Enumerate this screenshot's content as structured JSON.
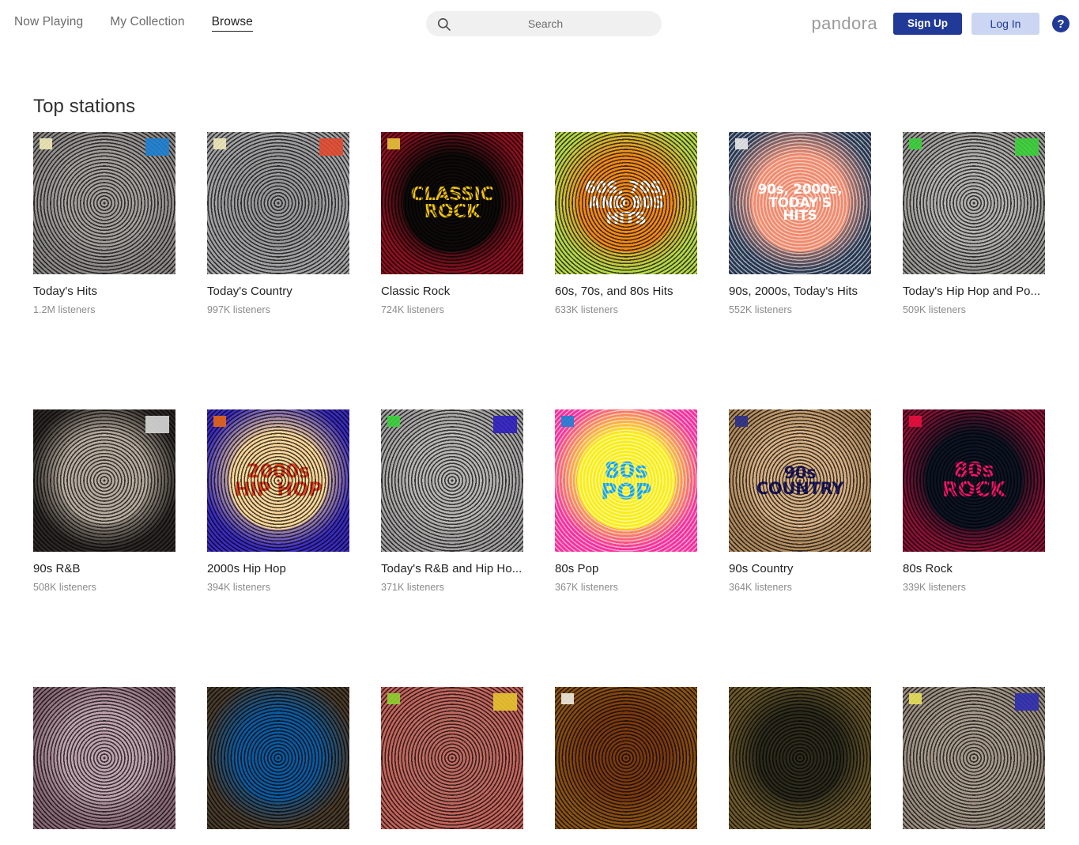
{
  "header": {
    "nav": [
      {
        "label": "Now Playing",
        "active": false
      },
      {
        "label": "My Collection",
        "active": false
      },
      {
        "label": "Browse",
        "active": true
      }
    ],
    "search": {
      "placeholder": "Search",
      "value": "",
      "icon": "search-icon"
    },
    "brand": "pandora",
    "sign_up_label": "Sign Up",
    "log_in_label": "Log In",
    "help_label": "?",
    "colors": {
      "brand_navy": "#223a97",
      "login_bg": "#ccd6f2",
      "search_bg": "#f0f0f0",
      "logo_gray": "#9b9b9b"
    }
  },
  "main": {
    "section_title": "Top stations",
    "stations": [
      {
        "title": "Today's Hits",
        "listeners": "1.2M listeners",
        "art": {
          "style": "photo",
          "bg": "#8d8a88",
          "disc": "#a5a19d",
          "label": "",
          "label_color": "#ffffff",
          "ring": "dark",
          "badge_tl": "#efe9b8",
          "badge_tr": "#1d7fd1"
        }
      },
      {
        "title": "Today's Country",
        "listeners": "997K listeners",
        "art": {
          "style": "photo",
          "bg": "#a3a2a4",
          "disc": "#9b9a9c",
          "label": "",
          "label_color": "#ffffff",
          "ring": "dark",
          "badge_tl": "#efe9b8",
          "badge_tr": "#e04a2f"
        }
      },
      {
        "title": "Classic Rock",
        "listeners": "724K listeners",
        "art": {
          "style": "graphic",
          "bg": "#8e1122",
          "disc": "#0d0a09",
          "label": "CLASSIC ROCK",
          "label_color": "#f2c411",
          "label_size": 23,
          "ring": "dark",
          "badge_tl": "#e8c53a",
          "badge_tr": ""
        }
      },
      {
        "title": "60s, 70s, and 80s Hits",
        "listeners": "633K listeners",
        "art": {
          "style": "graphic",
          "bg": "#b8d94a",
          "disc": "#f08a1c",
          "label": "60S, 70S, AND 80S HITS",
          "label_color": "#ffffff",
          "label_size": 20,
          "ring": "dark",
          "badge_tl": "",
          "badge_tr": ""
        }
      },
      {
        "title": "90s, 2000s, Today's Hits",
        "listeners": "552K listeners",
        "art": {
          "style": "graphic",
          "bg": "#24354f",
          "disc": "#ef8a6d",
          "label": "90s, 2000s, TODAY'S HITS",
          "label_color": "#ffffff",
          "label_size": 17,
          "ring": "light",
          "badge_tl": "#e8e8e8",
          "badge_tr": ""
        }
      },
      {
        "title": "Today's Hip Hop and Po...",
        "listeners": "509K listeners",
        "art": {
          "style": "photo",
          "bg": "#9d9b98",
          "disc": "#b4b2af",
          "label": "",
          "label_color": "#ffffff",
          "ring": "dark",
          "badge_tl": "#3ad13a",
          "badge_tr": "#3ad13a"
        }
      },
      {
        "title": "90s R&B",
        "listeners": "508K listeners",
        "art": {
          "style": "photo",
          "bg": "#2b2724",
          "disc": "#b8ada0",
          "label": "",
          "label_color": "#ffffff",
          "ring": "dark",
          "badge_tl": "",
          "badge_tr": "#d8d8d8"
        }
      },
      {
        "title": "2000s Hip Hop",
        "listeners": "394K listeners",
        "art": {
          "style": "graphic",
          "bg": "#3b2bc4",
          "disc": "#fcd79a",
          "label": "2000s HIP HOP",
          "label_color": "#e8441a",
          "label_size": 24,
          "ring": "dark",
          "badge_tl": "#e8661a",
          "badge_tr": ""
        }
      },
      {
        "title": "Today's R&B and Hip Ho...",
        "listeners": "371K listeners",
        "art": {
          "style": "photo",
          "bg": "#a2a0a0",
          "disc": "#b9b7b5",
          "label": "",
          "label_color": "#ffffff",
          "ring": "dark",
          "badge_tl": "#3ad13a",
          "badge_tr": "#2f1fc0"
        }
      },
      {
        "title": "80s Pop",
        "listeners": "367K listeners",
        "art": {
          "style": "graphic",
          "bg": "#f72f9c",
          "disc": "#f9ed19",
          "label": "80s POP",
          "label_color": "#13a3dd",
          "label_size": 28,
          "ring": "light",
          "badge_tl": "#1d7fd1",
          "badge_tr": ""
        }
      },
      {
        "title": "90s Country",
        "listeners": "364K listeners",
        "art": {
          "style": "graphic",
          "bg": "#b08b5e",
          "disc": "#d8b184",
          "label": "90s COUNTRY",
          "label_color": "#1f1a6e",
          "label_size": 21,
          "ring": "dark",
          "badge_tl": "#2b2f8a",
          "badge_tr": ""
        }
      },
      {
        "title": "80s Rock",
        "listeners": "339K listeners",
        "art": {
          "style": "graphic",
          "bg": "#8b1137",
          "disc": "#0d1424",
          "label": "80s ROCK",
          "label_color": "#f5156b",
          "label_size": 26,
          "ring": "dark",
          "badge_tl": "#e8103f",
          "badge_tr": ""
        }
      },
      {
        "title": "",
        "listeners": "",
        "art": {
          "style": "graphic",
          "bg": "#8b6a78",
          "disc": "#c0a4b0",
          "label": "",
          "label_color": "#ffffff",
          "ring": "dark",
          "badge_tl": "",
          "badge_tr": ""
        }
      },
      {
        "title": "",
        "listeners": "",
        "art": {
          "style": "graphic",
          "bg": "#4a3c2c",
          "disc": "#0d5a9e",
          "label": "",
          "label_color": "#ffffff",
          "ring": "dark",
          "badge_tl": "",
          "badge_tr": ""
        }
      },
      {
        "title": "",
        "listeners": "",
        "art": {
          "style": "graphic",
          "bg": "#c4645c",
          "disc": "#c06b62",
          "label": "",
          "label_color": "#ffffff",
          "ring": "dark",
          "badge_tl": "#8ed12f",
          "badge_tr": "#e8c32f"
        }
      },
      {
        "title": "",
        "listeners": "",
        "art": {
          "style": "graphic",
          "bg": "#8a5416",
          "disc": "#7a3a10",
          "label": "",
          "label_color": "#ffffff",
          "ring": "dark",
          "badge_tl": "#f0ece0",
          "badge_tr": ""
        }
      },
      {
        "title": "",
        "listeners": "",
        "art": {
          "style": "graphic",
          "bg": "#6d5a2c",
          "disc": "#2b2a1c",
          "label": "",
          "label_color": "#ffffff",
          "ring": "dark",
          "badge_tl": "",
          "badge_tr": ""
        }
      },
      {
        "title": "",
        "listeners": "",
        "art": {
          "style": "photo",
          "bg": "#9a8d80",
          "disc": "#a89b8d",
          "label": "",
          "label_color": "#ffffff",
          "ring": "dark",
          "badge_tl": "#e8e05a",
          "badge_tr": "#2f2fb0"
        }
      }
    ]
  }
}
